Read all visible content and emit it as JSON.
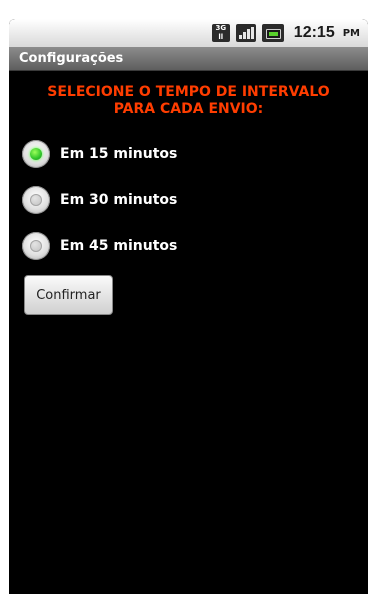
{
  "status_bar": {
    "network_badge": [
      "3G",
      "ll"
    ],
    "time": "12:15",
    "ampm": "PM",
    "icons": [
      "network-3g-icon",
      "signal-icon",
      "battery-icon"
    ]
  },
  "title_bar": {
    "title": "Configurações"
  },
  "heading": {
    "line1": "SELECIONE O TEMPO DE INTERVALO",
    "line2": "PARA CADA ENVIO:",
    "color": "#ff3d00"
  },
  "options": [
    {
      "label": "Em 15 minutos",
      "selected": true
    },
    {
      "label": "Em 30 minutos",
      "selected": false
    },
    {
      "label": "Em 45 minutos",
      "selected": false
    }
  ],
  "confirm_button": {
    "label": "Confirmar"
  }
}
